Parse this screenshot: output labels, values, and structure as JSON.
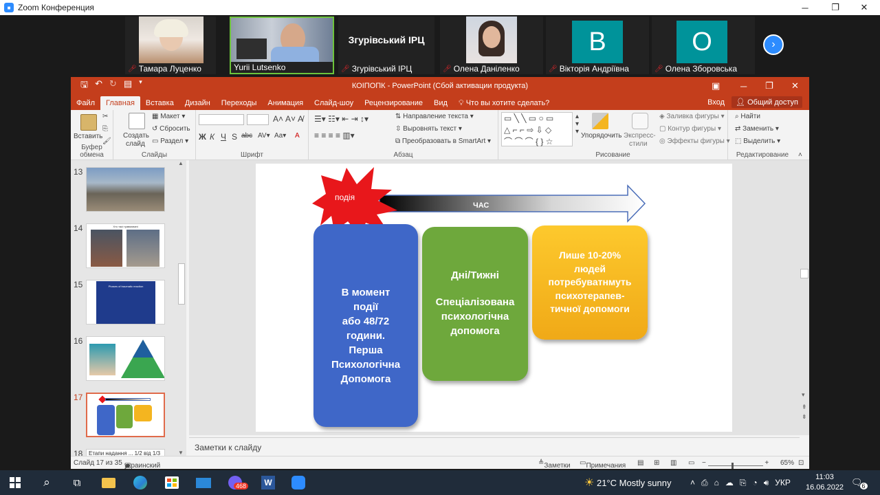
{
  "zoom": {
    "title": "Zoom Конференция",
    "participants": [
      {
        "name": "Тамара Луценко"
      },
      {
        "name": "Yurii Lutsenko"
      },
      {
        "name": "Згурівський ІРЦ",
        "label": "Згурівський ІРЦ"
      },
      {
        "name": "Олена Даніленко"
      },
      {
        "name": "Вікторія Андріївна",
        "letter": "В"
      },
      {
        "name": "Олена Зборовська",
        "letter": "О"
      }
    ]
  },
  "ppt": {
    "title": "КОІПОПК - PowerPoint (Сбой активации продукта)",
    "tabs": [
      "Файл",
      "Главная",
      "Вставка",
      "Дизайн",
      "Переходы",
      "Анимация",
      "Слайд-шоу",
      "Рецензирование",
      "Вид"
    ],
    "search": "Что вы хотите сделать?",
    "login": "Вход",
    "share": "Общий доступ",
    "ribbon": {
      "paste": "Вставить",
      "clipboard": "Буфер обмена",
      "create_slide_1": "Создать",
      "create_slide_2": "слайд",
      "layout": "Макет",
      "reset": "Сбросить",
      "section": "Раздел",
      "slides": "Слайды",
      "bold": "Ж",
      "italic": "К",
      "underline": "Ч",
      "strike": "S",
      "abc": "abc",
      "font": "Шрифт",
      "text_dir": "Направление текста",
      "align_text": "Выровнять текст",
      "smartart": "Преобразовать в SmartArt",
      "paragraph": "Абзац",
      "arrange": "Упорядочить",
      "quick_1": "Экспресс-",
      "quick_2": "стили",
      "fill": "Заливка фигуры",
      "outline": "Контур фигуры",
      "effects": "Эффекты фигуры",
      "drawing": "Рисование",
      "find": "Найти",
      "replace": "Заменить",
      "select": "Выделить",
      "editing": "Редактирование"
    },
    "thumbs": [
      {
        "num": "13"
      },
      {
        "num": "14",
        "caption": "Хто такі травмовані"
      },
      {
        "num": "15",
        "caption": "Phases of traumatic reaction"
      },
      {
        "num": "16"
      },
      {
        "num": "17"
      },
      {
        "num": "18",
        "caption": "Етапи надання ... 1/2 від 1/3"
      }
    ],
    "slide": {
      "event": "подія",
      "time": "ЧАС",
      "box1": [
        "В момент",
        "події",
        "або 48/72",
        "години.",
        "Перша",
        "Психологічна",
        "Допомога"
      ],
      "box2a": "Дні/Тижні",
      "box2b": [
        "Спеціалізована",
        "психологічна",
        "допомога"
      ],
      "box3": [
        "Лише 10-20%",
        "людей",
        "потребуватнмуть",
        "психотерапев-",
        "тичної допомоги"
      ]
    },
    "notes": "Заметки к слайду",
    "status": {
      "slide": "Слайд 17 из 35",
      "lang": "украинский",
      "notes": "Заметки",
      "comments": "Примечания",
      "zoom": "65%"
    }
  },
  "taskbar": {
    "weather": "21°C  Mostly sunny",
    "lang": "УКР",
    "time": "11:03",
    "date": "16.06.2022",
    "viber_badge": "468",
    "notif": "6"
  },
  "colors": {
    "ppt_red": "#c43e1c",
    "blue_box": "#3f67c8",
    "green_box": "#6ea83c",
    "gold_box": "#f4b520"
  }
}
